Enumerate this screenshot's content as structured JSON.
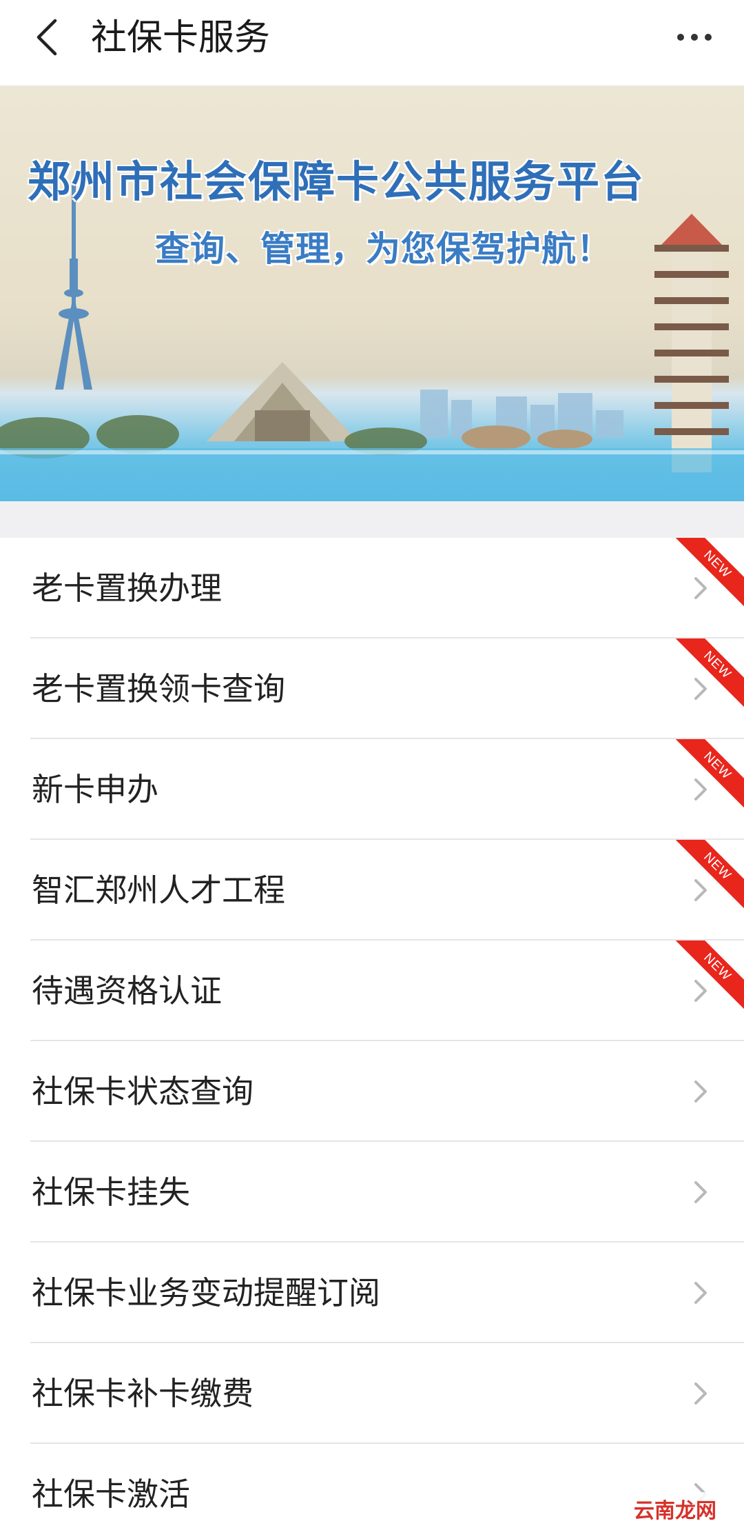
{
  "header": {
    "title": "社保卡服务",
    "back_icon": "chevron-left-icon",
    "more_icon": "more-dots-icon"
  },
  "banner": {
    "title": "郑州市社会保障卡公共服务平台",
    "subtitle": "查询、管理，为您保驾护航！"
  },
  "menu": {
    "items": [
      {
        "label": "老卡置换办理",
        "badge": "NEW"
      },
      {
        "label": "老卡置换领卡查询",
        "badge": "NEW"
      },
      {
        "label": "新卡申办",
        "badge": "NEW"
      },
      {
        "label": "智汇郑州人才工程",
        "badge": "NEW"
      },
      {
        "label": "待遇资格认证",
        "badge": "NEW"
      },
      {
        "label": "社保卡状态查询"
      },
      {
        "label": "社保卡挂失"
      },
      {
        "label": "社保卡业务变动提醒订阅"
      },
      {
        "label": "社保卡补卡缴费"
      },
      {
        "label": "社保卡激活"
      }
    ]
  },
  "watermark": "云南龙网",
  "colors": {
    "badge": "#e8261c",
    "banner_text": "#2f6fb8",
    "chevron": "#b8b8b8"
  }
}
